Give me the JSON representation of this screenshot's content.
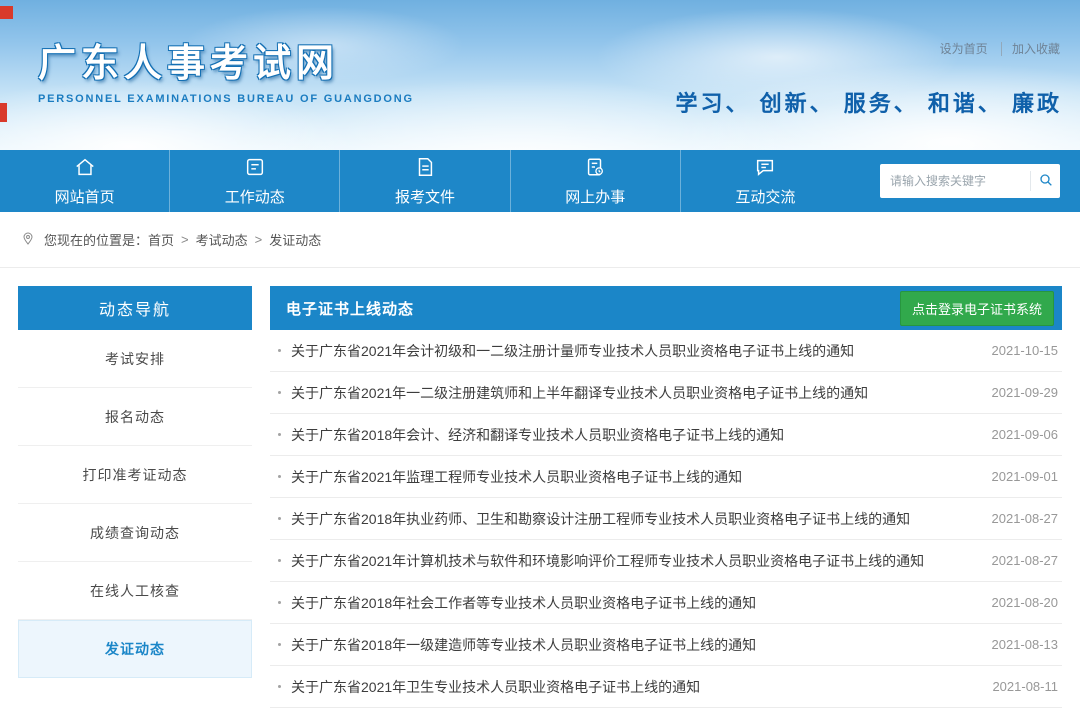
{
  "header": {
    "site_title": "广东人事考试网",
    "site_subtitle": "PERSONNEL EXAMINATIONS BUREAU OF GUANGDONG",
    "top_links": [
      "设为首页",
      "加入收藏"
    ],
    "slogan": "学习、 创新、 服务、 和谐、 廉政"
  },
  "nav": {
    "items": [
      {
        "label": "网站首页",
        "icon": "home-icon"
      },
      {
        "label": "工作动态",
        "icon": "news-icon"
      },
      {
        "label": "报考文件",
        "icon": "document-icon"
      },
      {
        "label": "网上办事",
        "icon": "online-service-icon"
      },
      {
        "label": "互动交流",
        "icon": "chat-icon"
      }
    ],
    "search_placeholder": "请输入搜索关键字"
  },
  "breadcrumb": {
    "prefix": "您现在的位置是：",
    "separator": ">",
    "items": [
      "首页",
      "考试动态",
      "发证动态"
    ]
  },
  "sidebar": {
    "title": "动态导航",
    "items": [
      {
        "label": "考试安排",
        "active": false
      },
      {
        "label": "报名动态",
        "active": false
      },
      {
        "label": "打印准考证动态",
        "active": false
      },
      {
        "label": "成绩查询动态",
        "active": false
      },
      {
        "label": "在线人工核查",
        "active": false
      },
      {
        "label": "发证动态",
        "active": true
      }
    ]
  },
  "main": {
    "title": "电子证书上线动态",
    "login_button": "点击登录电子证书系统",
    "notices": [
      {
        "title": "关于广东省2021年会计初级和一二级注册计量师专业技术人员职业资格电子证书上线的通知",
        "date": "2021-10-15"
      },
      {
        "title": "关于广东省2021年一二级注册建筑师和上半年翻译专业技术人员职业资格电子证书上线的通知",
        "date": "2021-09-29"
      },
      {
        "title": "关于广东省2018年会计、经济和翻译专业技术人员职业资格电子证书上线的通知",
        "date": "2021-09-06"
      },
      {
        "title": "关于广东省2021年监理工程师专业技术人员职业资格电子证书上线的通知",
        "date": "2021-09-01"
      },
      {
        "title": "关于广东省2018年执业药师、卫生和勘察设计注册工程师专业技术人员职业资格电子证书上线的通知",
        "date": "2021-08-27"
      },
      {
        "title": "关于广东省2021年计算机技术与软件和环境影响评价工程师专业技术人员职业资格电子证书上线的通知",
        "date": "2021-08-27"
      },
      {
        "title": "关于广东省2018年社会工作者等专业技术人员职业资格电子证书上线的通知",
        "date": "2021-08-20"
      },
      {
        "title": "关于广东省2018年一级建造师等专业技术人员职业资格电子证书上线的通知",
        "date": "2021-08-13"
      },
      {
        "title": "关于广东省2021年卫生专业技术人员职业资格电子证书上线的通知",
        "date": "2021-08-11"
      }
    ]
  },
  "colors": {
    "primary_blue": "#1e87c8",
    "panel_blue": "#1b86c8",
    "button_green": "#31a94c",
    "slogan_blue": "#0f60aa"
  }
}
